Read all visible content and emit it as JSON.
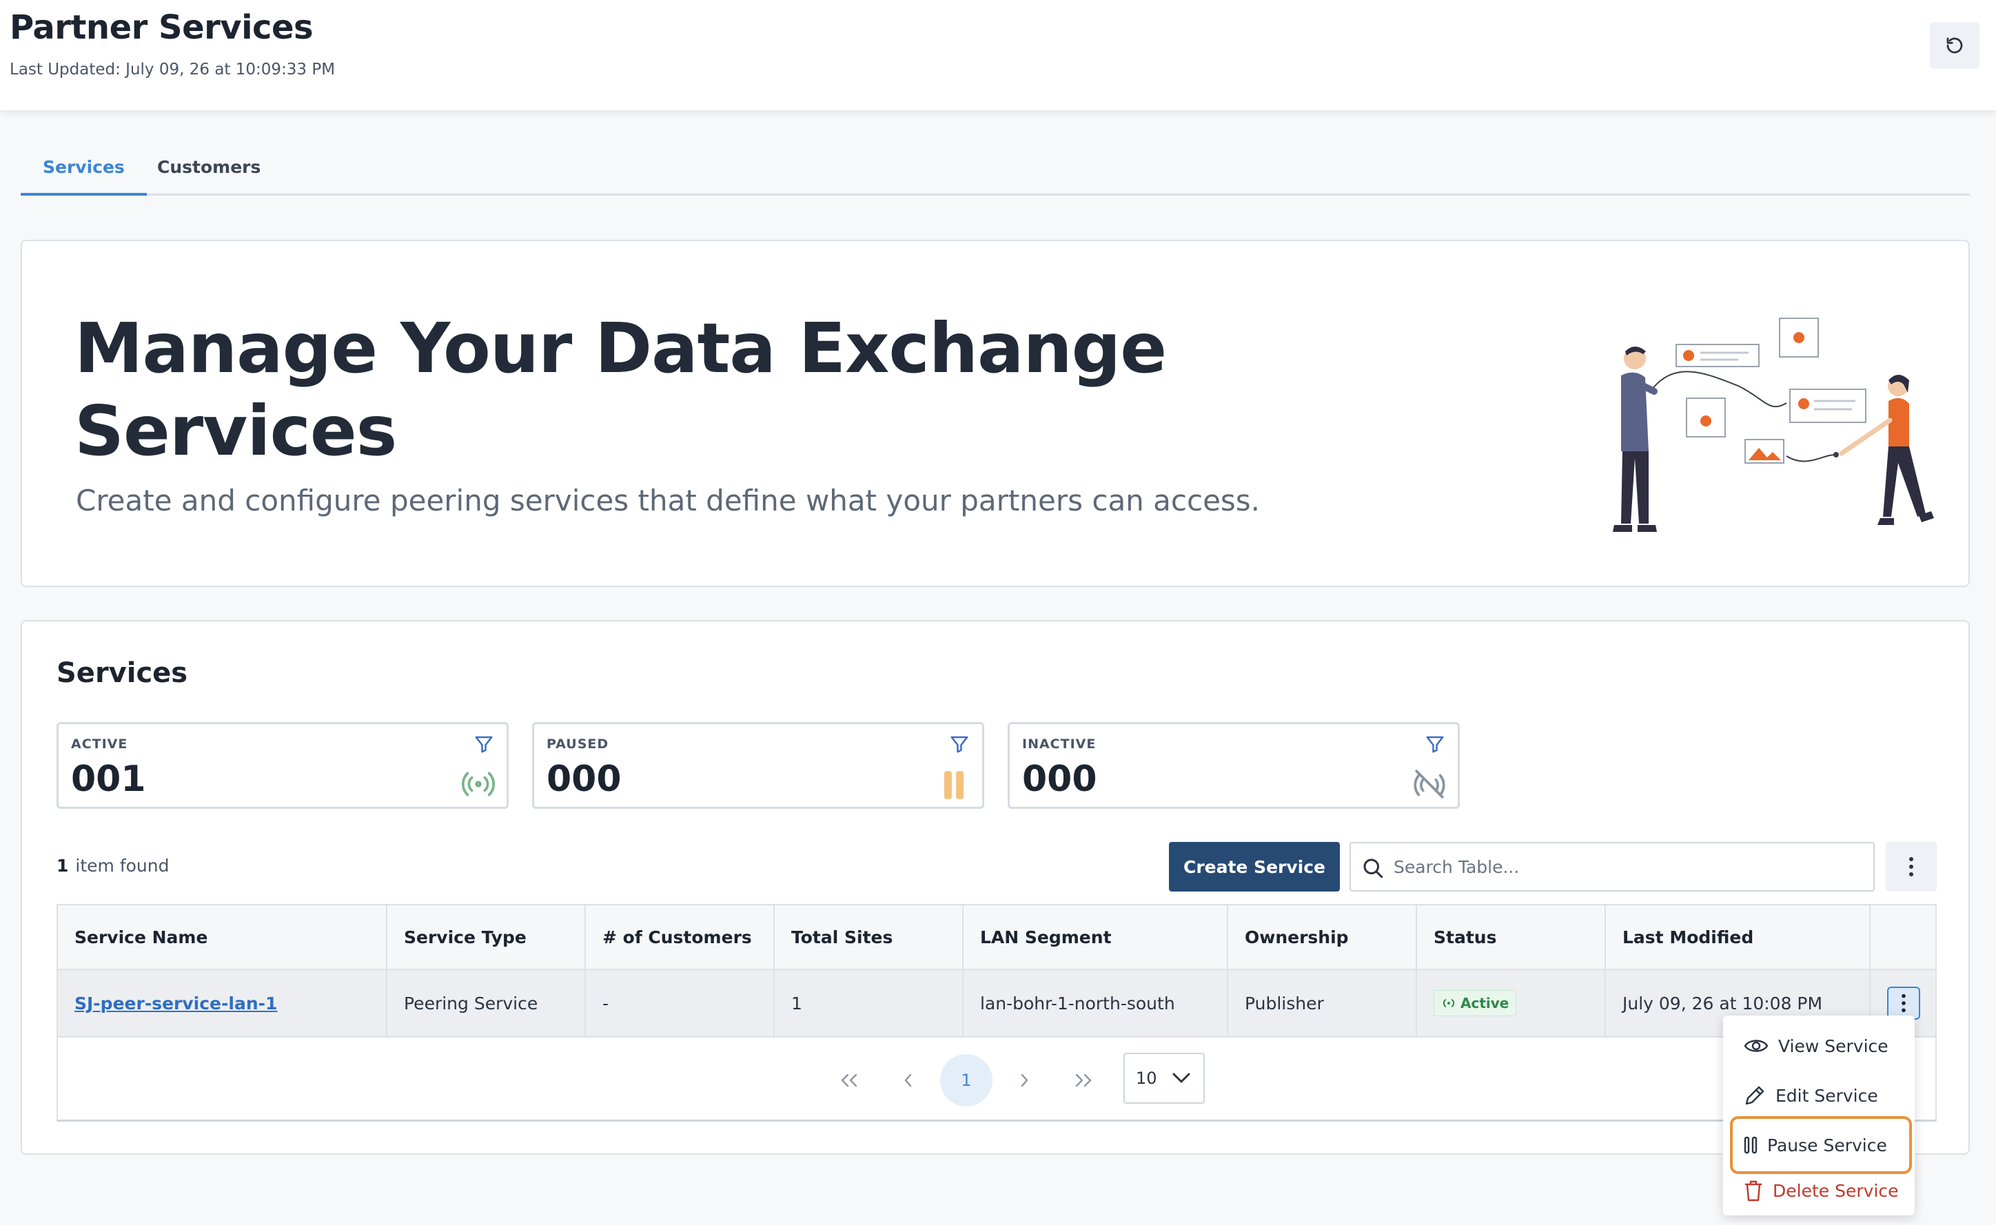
{
  "header": {
    "title": "Partner Services",
    "last_updated": "Last Updated: July 09, 26 at 10:09:33 PM"
  },
  "tabs": [
    {
      "label": "Services",
      "active": true
    },
    {
      "label": "Customers",
      "active": false
    }
  ],
  "hero": {
    "title": "Manage Your Data Exchange Services",
    "subtitle": "Create and configure peering services that define what your partners can access."
  },
  "services": {
    "heading": "Services",
    "stats": [
      {
        "label": "ACTIVE",
        "value": "001",
        "icon": "broadcast-icon",
        "color": "#7bb38a"
      },
      {
        "label": "PAUSED",
        "value": "000",
        "icon": "pause-icon",
        "color": "#f4c27f"
      },
      {
        "label": "INACTIVE",
        "value": "000",
        "icon": "signal-off-icon",
        "color": "#8a94a3"
      }
    ],
    "items_count": "1",
    "items_label": "item found",
    "create_label": "Create Service",
    "search_placeholder": "Search Table..."
  },
  "table": {
    "columns": [
      "Service Name",
      "Service Type",
      "# of Customers",
      "Total Sites",
      "LAN Segment",
      "Ownership",
      "Status",
      "Last Modified"
    ],
    "rows": [
      {
        "service_name": "SJ-peer-service-lan-1",
        "service_type": "Peering Service",
        "customers": "-",
        "total_sites": "1",
        "lan_segment": "lan-bohr-1-north-south",
        "ownership": "Publisher",
        "status": "Active",
        "last_modified": "July 09, 26 at 10:08 PM"
      }
    ]
  },
  "pagination": {
    "current_page": "1",
    "page_size": "10"
  },
  "row_menu": {
    "items": [
      "View Service",
      "Edit Service",
      "Pause Service",
      "Delete Service"
    ]
  },
  "colors": {
    "accent": "#3a86d6",
    "primary_button": "#274a75",
    "highlight": "#e8913a",
    "danger": "#c0392b",
    "illustration_accent": "#e8692a"
  }
}
